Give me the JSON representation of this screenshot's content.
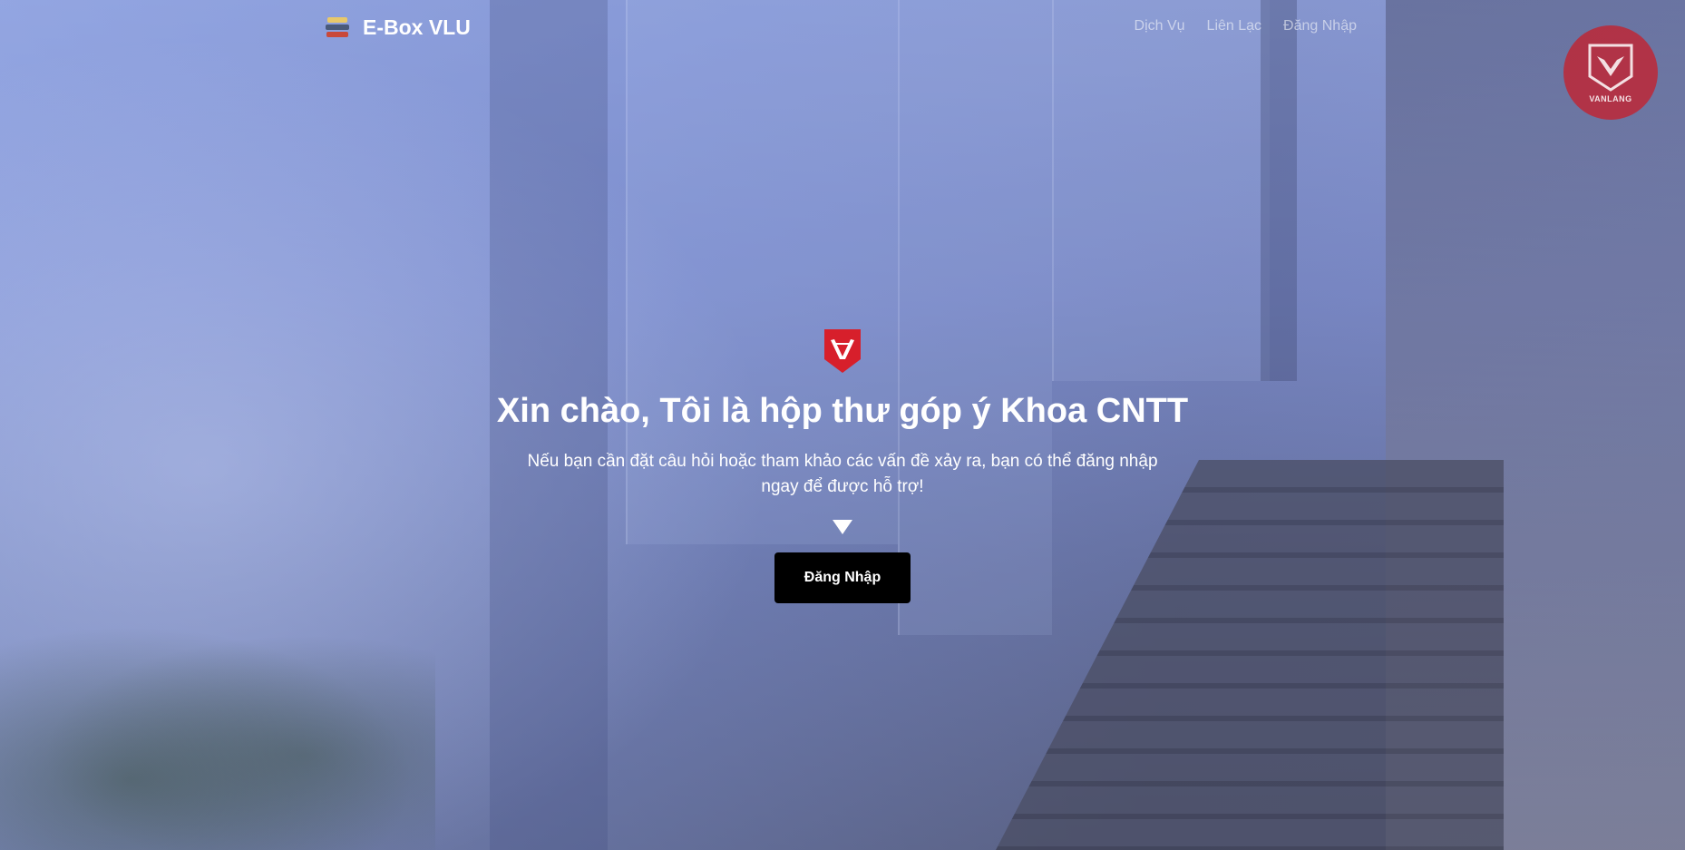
{
  "brand": {
    "name": "E-Box VLU",
    "icon": "books-icon"
  },
  "nav": {
    "links": [
      {
        "label": "Dịch Vụ"
      },
      {
        "label": "Liên Lạc"
      },
      {
        "label": "Đăng Nhập"
      }
    ]
  },
  "corner_logo": {
    "text": "VANLANG",
    "icon": "vanlang-shield-logo"
  },
  "hero": {
    "icon": "vanlang-shield-icon",
    "headline": "Xin chào, Tôi là hộp thư góp ý Khoa CNTT",
    "subtitle": "Nếu bạn cần đặt câu hỏi hoặc tham khảo các vấn đề xảy ra, bạn có thể đăng nhập ngay để được hỗ trợ!",
    "arrow_icon": "down-arrow-icon",
    "cta_label": "Đăng Nhập"
  },
  "colors": {
    "brand_red": "#d71f2b",
    "cta_bg": "#000000",
    "text": "#ffffff"
  }
}
